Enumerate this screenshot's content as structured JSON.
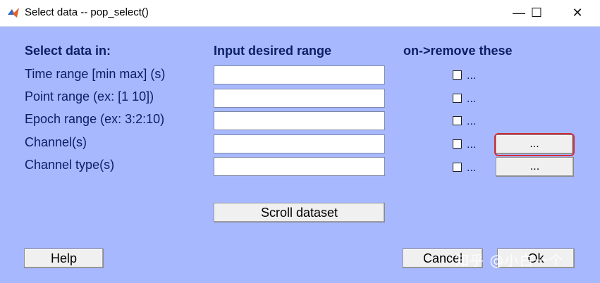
{
  "window": {
    "title": "Select data -- pop_select()",
    "controls": {
      "minimize": "—",
      "maximize": "☐",
      "close": "✕"
    }
  },
  "headers": {
    "select_in": "Select data in:",
    "range": "Input desired range",
    "remove": "on->remove these"
  },
  "rows": [
    {
      "label": "Time range [min max] (s)",
      "value": "",
      "remove_checked": false
    },
    {
      "label": "Point range (ex: [1 10])",
      "value": "",
      "remove_checked": false
    },
    {
      "label": "Epoch range (ex: 3:2:10)",
      "value": "",
      "remove_checked": false
    },
    {
      "label": "Channel(s)",
      "value": "",
      "remove_checked": false
    },
    {
      "label": "Channel type(s)",
      "value": "",
      "remove_checked": false
    }
  ],
  "ellipsis": "...",
  "buttons": {
    "scroll": "Scroll dataset",
    "help": "Help",
    "cancel": "Cancel",
    "ok": "Ok",
    "browse": "..."
  },
  "watermark": "知乎 @小白一个",
  "colors": {
    "background": "#a7b8ff",
    "label_text": "#0b1e63",
    "highlight": "#d0303a"
  }
}
